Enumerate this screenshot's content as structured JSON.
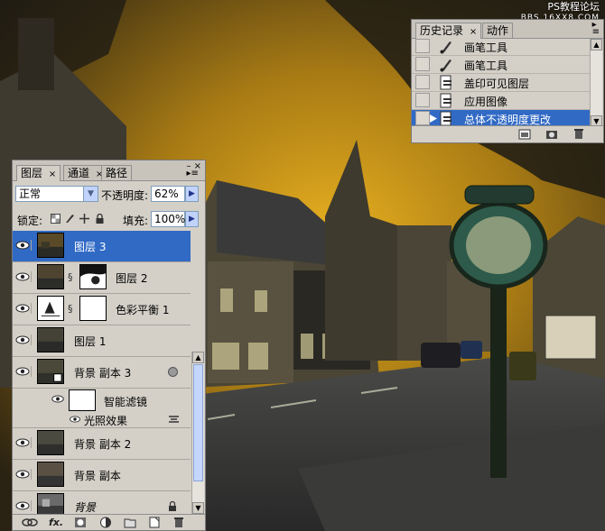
{
  "watermark": {
    "line1": "PS教程论坛",
    "line2": "BBS.16XX8.COM"
  },
  "history_panel": {
    "tabs": [
      {
        "label": "历史记录"
      },
      {
        "label": "动作"
      }
    ],
    "items": [
      {
        "label": "画笔工具",
        "icon": "brush-icon"
      },
      {
        "label": "画笔工具",
        "icon": "brush-icon"
      },
      {
        "label": "盖印可见图层",
        "icon": "document-icon"
      },
      {
        "label": "应用图像",
        "icon": "document-icon"
      },
      {
        "label": "总体不透明度更改",
        "icon": "document-icon",
        "selected": true
      }
    ],
    "footer_icons": [
      "new-document-from-state-icon",
      "snapshot-icon",
      "trash-icon"
    ]
  },
  "layers_panel": {
    "tabs": [
      {
        "label": "图层"
      },
      {
        "label": "通道"
      },
      {
        "label": "路径"
      }
    ],
    "blend_mode": "正常",
    "opacity_label": "不透明度:",
    "opacity_value": "62%",
    "lock_label": "锁定:",
    "fill_label": "填充:",
    "fill_value": "100%",
    "layers": [
      {
        "name": "图层 3",
        "selected": true
      },
      {
        "name": "图层 2"
      },
      {
        "name": "色彩平衡 1"
      },
      {
        "name": "图层 1"
      },
      {
        "name": "背景 副本 3"
      },
      {
        "name": "智能滤镜"
      },
      {
        "name": "光照效果"
      },
      {
        "name": "背景 副本 2"
      },
      {
        "name": "背景 副本"
      },
      {
        "name": "背景"
      }
    ],
    "footer_icons": [
      "link-icon",
      "fx-icon",
      "mask-icon",
      "adjustment-icon",
      "group-folder-icon",
      "new-layer-icon",
      "trash-icon"
    ],
    "fx_label": "fx."
  },
  "colors": {
    "selection": "#316ac5",
    "panel_bg": "#d4d0c8",
    "sky": "#b8860b"
  }
}
